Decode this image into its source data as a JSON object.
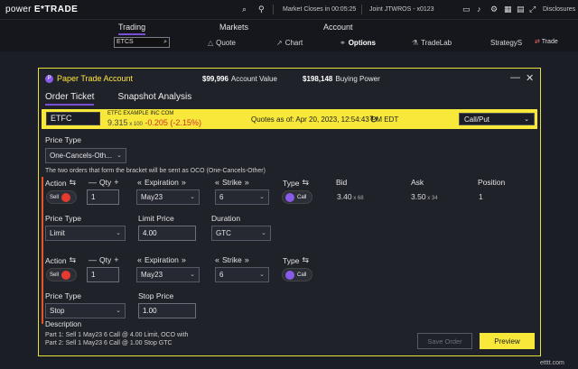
{
  "topbar": {
    "brand_pre": "power ",
    "brand_post": "E*TRADE",
    "market": "Market Closes in 00:05:25",
    "account": "Joint JTWROS - x0123",
    "disclosures": "Disclosures",
    "icons": [
      "search-icon",
      "location-icon",
      "message-icon",
      "bell-icon",
      "gear-icon",
      "layout-icon",
      "layout-icon",
      "expand-icon"
    ]
  },
  "nav": {
    "tabs": [
      "Trading",
      "Markets",
      "Account"
    ],
    "symbol": "ETCS",
    "subtabs": [
      {
        "icon": "△",
        "label": "Quote"
      },
      {
        "icon": "↗",
        "label": "Chart"
      },
      {
        "icon": "⚭",
        "label": "Options"
      },
      {
        "icon": "⚗",
        "label": "TradeLab"
      },
      {
        "icon": "",
        "label": "StrategyS"
      }
    ],
    "trade": "Trade"
  },
  "modal": {
    "title": "Paper Trade Account",
    "account_value": "$99,996",
    "account_value_label": "Account Value",
    "buying_power": "$198,148",
    "buying_power_label": "Buying Power",
    "tabs": [
      "Order Ticket",
      "Snapshot Analysis"
    ]
  },
  "quote": {
    "symbol": "ETFC",
    "name": "ETFC EXAMPLE INC COM",
    "last": "9.315",
    "size": " x 100",
    "change": "-0.205 (-2.15%)",
    "asof_label": "Quotes as of:",
    "asof": "Apr 20, 2023, 12:54:43 PM EDT",
    "type": "Call/Put"
  },
  "form": {
    "price_type_label": "Price Type",
    "price_type_value": "One-Cancels-Oth...",
    "note": "The two orders that form the bracket will be sent as OCO (One-Cancels-Other)",
    "headers": {
      "action": "Action",
      "qty": "Qty",
      "expiration": "Expiration",
      "strike": "Strike",
      "type": "Type",
      "bid": "Bid",
      "ask": "Ask",
      "position": "Position"
    },
    "leg1": {
      "action": "Sell",
      "qty": "1",
      "expiration": "May23",
      "strike": "6",
      "type": "Call",
      "bid": "3.40",
      "bid_size": " x 68",
      "ask": "3.50",
      "ask_size": " x 34",
      "position": "1",
      "price_type_label": "Price Type",
      "price_type": "Limit",
      "limit_label": "Limit Price",
      "limit": "4.00",
      "duration_label": "Duration",
      "duration": "GTC"
    },
    "leg2": {
      "action": "Sell",
      "qty": "1",
      "expiration": "May23",
      "strike": "6",
      "type": "Call",
      "price_type_label": "Price Type",
      "price_type": "Stop",
      "stop_label": "Stop Price",
      "stop": "1.00"
    },
    "description_label": "Description",
    "description": [
      "Part 1: Sell 1 May23 6 Call @ 4.00 Limit, OCO with",
      "Part 2: Sell 1 May23 6 Call @ 1.00 Stop GTC"
    ],
    "save_label": "Save Order",
    "preview_label": "Preview"
  },
  "watermark": "etttt.com"
}
